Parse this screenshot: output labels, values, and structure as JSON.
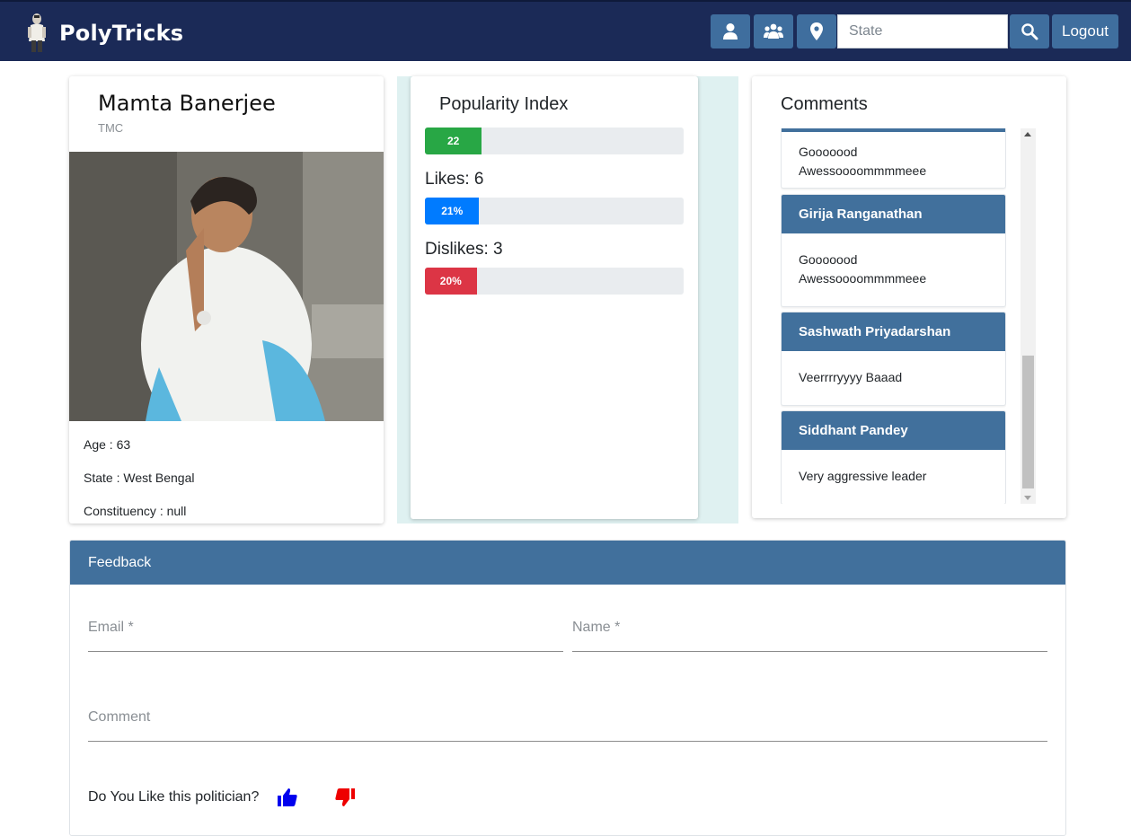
{
  "navbar": {
    "brand": "PolyTricks",
    "search_placeholder": "State",
    "logout_label": "Logout",
    "icons": [
      "user-icon",
      "users-group-icon",
      "location-pin-icon",
      "search-icon"
    ]
  },
  "politician": {
    "name": "Mamta Banerjee",
    "party": "TMC",
    "age_line": "Age : 63",
    "state_line": "State : West Bengal",
    "constituency_line": "Constituency : null"
  },
  "popularity": {
    "title": "Popularity Index",
    "index_value": 22,
    "index_label": "22",
    "likes_caption": "Likes: 6",
    "likes_percent": 21,
    "likes_label": "21%",
    "dislikes_caption": "Dislikes: 3",
    "dislikes_percent": 20,
    "dislikes_label": "20%",
    "colors": {
      "index": "#28a745",
      "likes": "#007bff",
      "dislikes": "#dc3545"
    }
  },
  "comments": {
    "title": "Comments",
    "items": [
      {
        "author": "",
        "text_lines": [
          "Gooooood",
          "Awessoooommmmeee"
        ]
      },
      {
        "author": "Girija Ranganathan",
        "text_lines": [
          "Gooooood",
          "Awessoooommmmeee"
        ]
      },
      {
        "author": "Sashwath Priyadarshan",
        "text_lines": [
          "Veerrrryyyy Baaad"
        ]
      },
      {
        "author": "Siddhant Pandey",
        "text_lines": [
          "Very aggressive leader"
        ]
      }
    ]
  },
  "feedback": {
    "title": "Feedback",
    "email_label": "Email *",
    "name_label": "Name *",
    "comment_label": "Comment",
    "like_question": "Do You Like this politician?",
    "like_icon": "thumbs-up-icon",
    "dislike_icon": "thumbs-down-icon",
    "like_color": "#0000ee",
    "dislike_color": "#ee0000"
  }
}
